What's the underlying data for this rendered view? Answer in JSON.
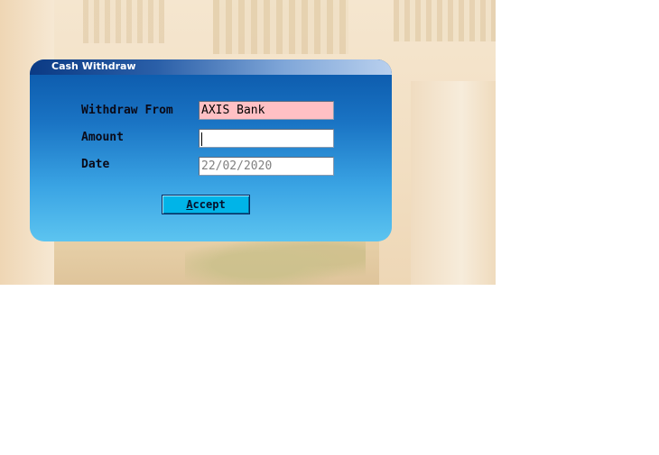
{
  "window": {
    "title": "Cash Withdraw"
  },
  "form": {
    "withdraw_from_label": "Withdraw From",
    "withdraw_from_value": "AXIS Bank",
    "amount_label": "Amount",
    "amount_value": "",
    "date_label": "Date",
    "date_value": "22/02/2020"
  },
  "buttons": {
    "accept_mnemonic": "A",
    "accept_rest": "ccept"
  },
  "colors": {
    "withdraw_from_field_bg": "#ffc0c4",
    "accept_button_bg": "#00b4e8",
    "dialog_gradient_top": "#0a56a8",
    "dialog_gradient_bottom": "#5cc4f0"
  }
}
